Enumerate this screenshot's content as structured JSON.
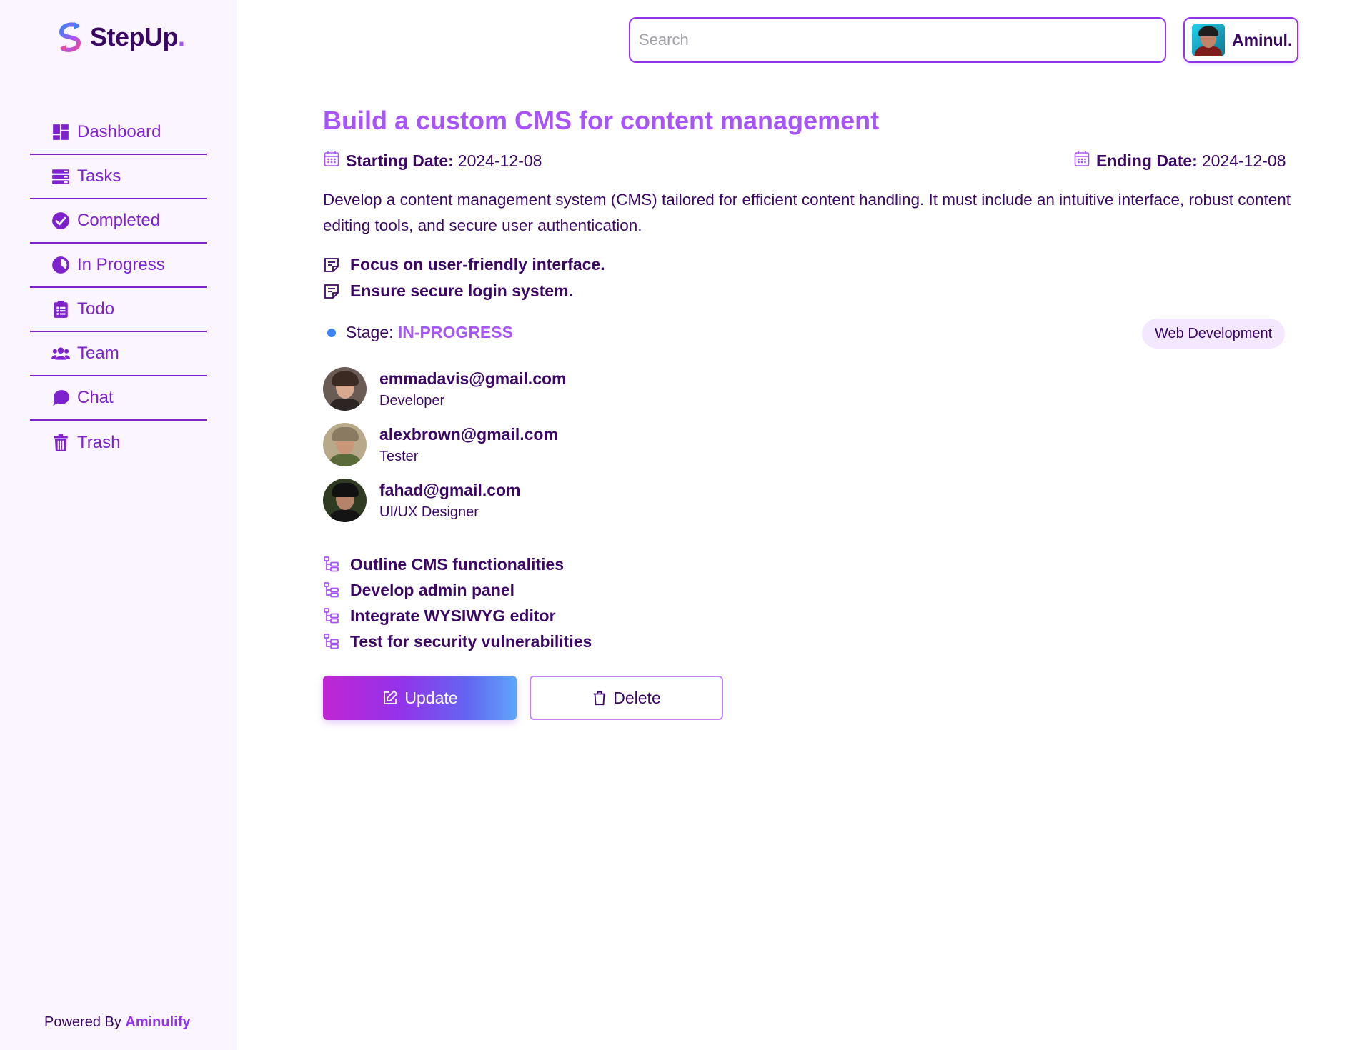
{
  "app": {
    "logo_text": "StepUp",
    "logo_dot": ".",
    "powered_prefix": "Powered By ",
    "powered_brand": "Aminulify"
  },
  "sidebar": {
    "items": [
      {
        "label": "Dashboard",
        "icon": "dashboard-icon"
      },
      {
        "label": "Tasks",
        "icon": "tasks-icon"
      },
      {
        "label": "Completed",
        "icon": "check-circle-icon"
      },
      {
        "label": "In Progress",
        "icon": "progress-icon"
      },
      {
        "label": "Todo",
        "icon": "clipboard-list-icon"
      },
      {
        "label": "Team",
        "icon": "users-icon"
      },
      {
        "label": "Chat",
        "icon": "chat-icon"
      },
      {
        "label": "Trash",
        "icon": "trash-icon"
      }
    ]
  },
  "header": {
    "search_placeholder": "Search",
    "search_value": "",
    "user_name": "Aminul."
  },
  "task": {
    "title": "Build a custom CMS for content management",
    "start_label": "Starting Date:",
    "start_date": "2024-12-08",
    "end_label": "Ending Date:",
    "end_date": "2024-12-08",
    "description": "Develop a content management system (CMS) tailored for efficient content handling. It must include an intuitive interface, robust content editing tools, and secure user authentication.",
    "notes": [
      "Focus on user-friendly interface.",
      "Ensure secure login system."
    ],
    "stage_label": "Stage:",
    "stage_value": "IN-PROGRESS",
    "category": "Web Development",
    "members": [
      {
        "email": "emmadavis@gmail.com",
        "role": "Developer"
      },
      {
        "email": "alexbrown@gmail.com",
        "role": "Tester"
      },
      {
        "email": "fahad@gmail.com",
        "role": "UI/UX Designer"
      }
    ],
    "subtasks": [
      "Outline CMS functionalities",
      "Develop admin panel",
      "Integrate WYSIWYG editor",
      "Test for security vulnerabilities"
    ]
  },
  "actions": {
    "update_label": "Update",
    "delete_label": "Delete"
  },
  "colors": {
    "accent": "#a855f7",
    "dark_text": "#3b0764",
    "sidebar_bg": "#faf5ff",
    "stage_dot": "#3b82f6"
  }
}
